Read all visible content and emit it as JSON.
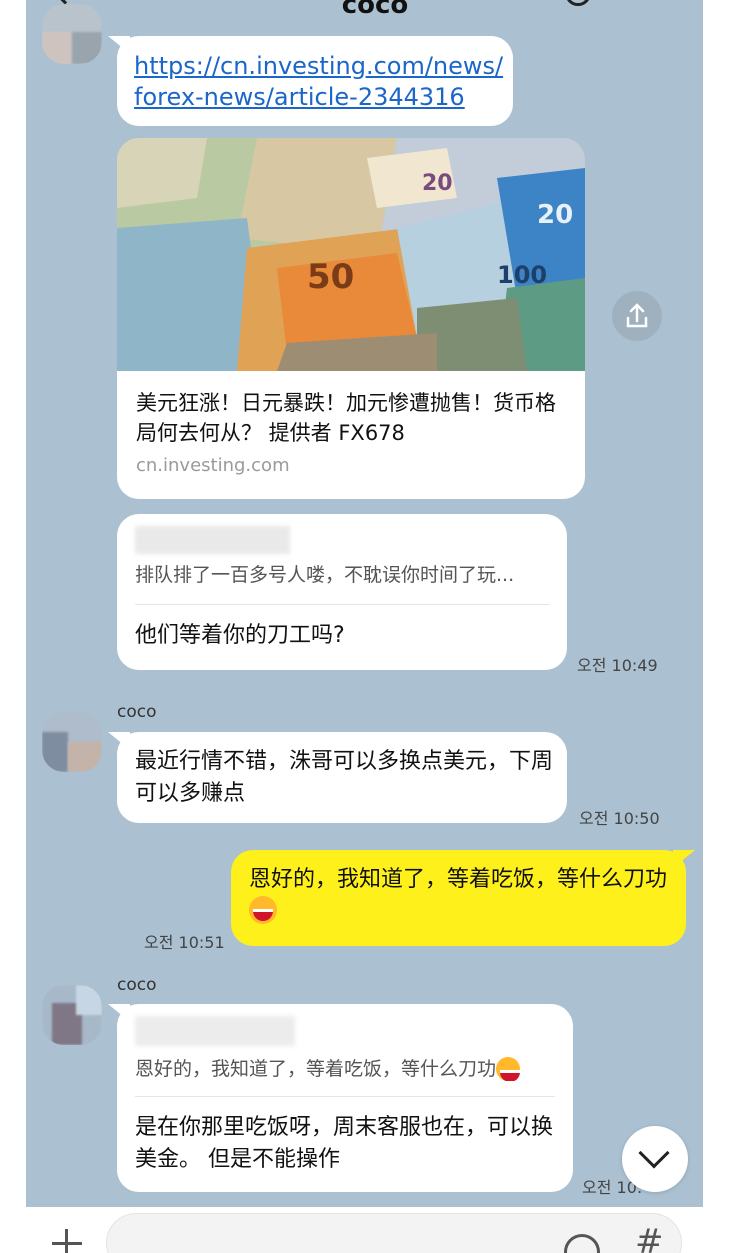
{
  "header": {
    "title": "coco"
  },
  "messages": {
    "link_url_line1": "https://cn.investing.com/news/",
    "link_url_line2": "forex-news/article-2344316",
    "card_title": "美元狂涨！日元暴跌！加元惨遭抛售！货币格局何去何从？ 提供者 FX678",
    "card_domain": "cn.investing.com",
    "reply1_quote": "排队排了一百多号人喽，不耽误你时间了玩...",
    "reply1_text": "他们等着你的刀工吗?",
    "reply1_time": "오전 10:49",
    "sender2": "coco",
    "msg2_text": "最近行情不错，洙哥可以多换点美元，下周可以多赚点",
    "msg2_time": "오전 10:50",
    "mine_text": "恩好的，我知道了，等着吃饭，等什么刀功",
    "mine_time": "오전 10:51",
    "sender3": "coco",
    "reply2_quote": "恩好的，我知道了，等着吃饭，等什么刀功",
    "reply2_text": "是在你那里吃饭呀，周末客服也在，可以换美金。 但是不能操作",
    "reply2_time": "오전 10:"
  },
  "icons": {
    "back": "back-arrow-icon",
    "search": "search-icon",
    "menu": "menu-icon",
    "share": "share-icon",
    "scroll_down": "chevron-down-icon",
    "attach": "plus-icon",
    "emoji": "emoji-icon",
    "hash": "hash-icon",
    "laugh": "laughing-emoji-icon"
  },
  "colors": {
    "chat_bg": "#abc1d1",
    "my_bubble": "#fef01b",
    "their_bubble": "#ffffff",
    "link": "#1a66c9"
  }
}
